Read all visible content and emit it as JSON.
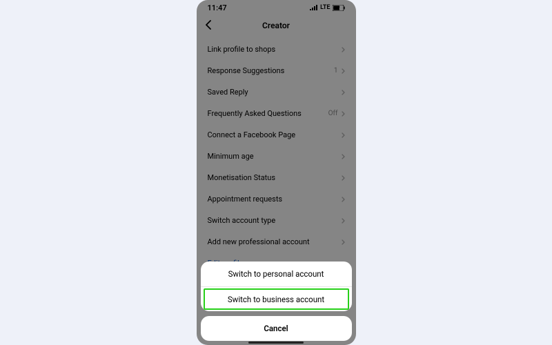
{
  "status": {
    "time": "11:47",
    "network": "LTE",
    "battery": "62"
  },
  "header": {
    "title": "Creator"
  },
  "settings": [
    {
      "label": "Link profile to shops",
      "value": ""
    },
    {
      "label": "Response Suggestions",
      "value": "1"
    },
    {
      "label": "Saved Reply",
      "value": ""
    },
    {
      "label": "Frequently Asked Questions",
      "value": "Off"
    },
    {
      "label": "Connect a Facebook Page",
      "value": ""
    },
    {
      "label": "Minimum age",
      "value": ""
    },
    {
      "label": "Monetisation Status",
      "value": ""
    },
    {
      "label": "Appointment requests",
      "value": ""
    },
    {
      "label": "Switch account type",
      "value": ""
    },
    {
      "label": "Add new professional account",
      "value": ""
    }
  ],
  "link": {
    "edit_profile": "Edit profile"
  },
  "sheet": {
    "option_personal": "Switch to personal account",
    "option_business": "Switch to business account",
    "cancel": "Cancel"
  }
}
